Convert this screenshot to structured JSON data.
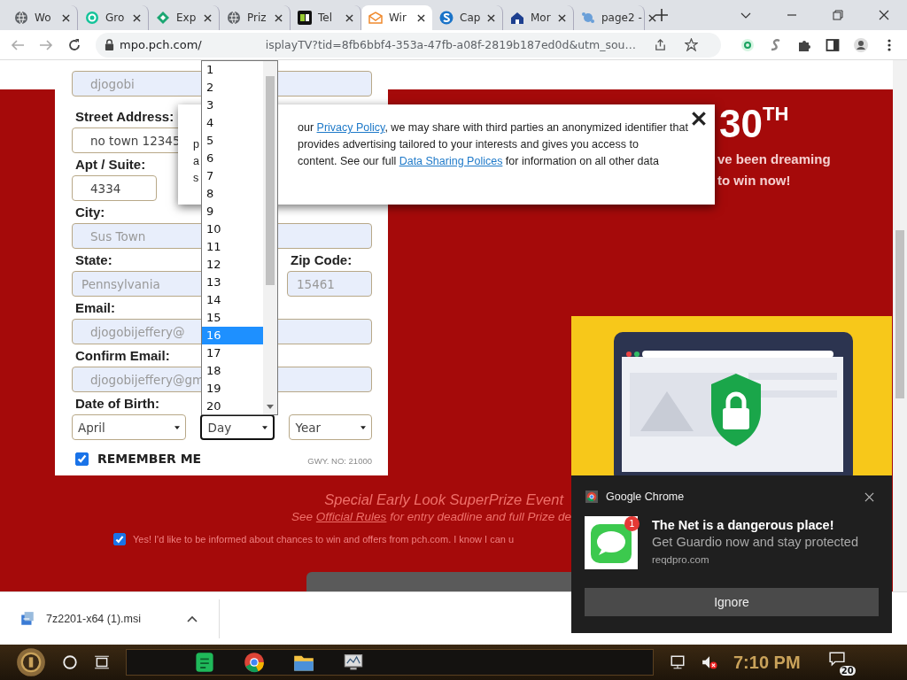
{
  "tabs": [
    {
      "label": "Wo",
      "kind": "globe",
      "selected": false
    },
    {
      "label": "Gro",
      "kind": "ring",
      "selected": false
    },
    {
      "label": "Exp",
      "kind": "diamond",
      "selected": false
    },
    {
      "label": "Priz",
      "kind": "globe",
      "selected": false
    },
    {
      "label": "Tel",
      "kind": "square",
      "selected": false
    },
    {
      "label": "Wir",
      "kind": "mail",
      "selected": true
    },
    {
      "label": "Cap",
      "kind": "circle",
      "selected": false
    },
    {
      "label": "Mor",
      "kind": "house",
      "selected": false
    },
    {
      "label": "page2 -",
      "kind": "splash",
      "selected": false
    }
  ],
  "address": {
    "start": "mpo.pch.com/",
    "end": "isplayTV?tid=8fb6bbf4-353a-47fb-a08f-2819b187ed0d&utm_sou…"
  },
  "form": {
    "top_value": "djogobi",
    "rows": [
      {
        "kind": "field",
        "label": "Street Address:",
        "value": "no town 12345",
        "disabled": false
      },
      {
        "kind": "short",
        "label": "Apt / Suite:",
        "value": "4334",
        "disabled": false
      },
      {
        "kind": "field",
        "label": "City:",
        "value": "Sus Town",
        "disabled": true
      },
      {
        "kind": "pair",
        "label": "State:",
        "value": "Pennsylvania",
        "disabled": true,
        "label_2": "Zip Code:",
        "value_2": "15461"
      },
      {
        "kind": "field",
        "label": "Email:",
        "value": "djogobijeffery@",
        "disabled": true
      },
      {
        "kind": "field",
        "label": "Confirm Email:",
        "value": "djogobijeffery@gm",
        "disabled": true
      },
      {
        "kind": "selects",
        "label": "Date of Birth:",
        "selects": [
          {
            "value": "April",
            "focused": false
          },
          {
            "value": "Day",
            "focused": true
          },
          {
            "value": "Year",
            "focused": false
          }
        ]
      }
    ],
    "remember": {
      "label": "REMEMBER ME",
      "checked": true
    },
    "gwy": "GWY. NO: 21000"
  },
  "hero": {
    "number": "30",
    "suffix": "TH",
    "lines": [
      "ve been dreaming",
      "to win now!"
    ]
  },
  "event": {
    "title": "Special Early Look SuperPrize Event",
    "rules_before": "See ",
    "rules_link": "Official Rules",
    "rules_after": " for entry deadline and full Prize de",
    "optin": {
      "checked": true,
      "text": "Yes! I'd like to be informed about chances to win and offers from pch.com. I know I can u"
    }
  },
  "popup": {
    "leads": [
      "p",
      "a",
      "s"
    ],
    "lines": [
      [
        {
          "text": "our ",
          "link": false
        },
        {
          "text": "Privacy Policy",
          "link": true
        },
        {
          "text": ", we may share with third parties an anonymized identifier that",
          "link": false
        }
      ],
      [
        {
          "text": "provides advertising tailored to your interests and gives you access to",
          "link": false
        }
      ],
      [
        {
          "text": "content. See our full ",
          "link": false
        },
        {
          "text": "Data Sharing Polices",
          "link": true
        },
        {
          "text": " for information on all other data",
          "link": false
        }
      ]
    ]
  },
  "dropdown": {
    "items": [
      {
        "label": "1",
        "selected": false
      },
      {
        "label": "2",
        "selected": false
      },
      {
        "label": "3",
        "selected": false
      },
      {
        "label": "4",
        "selected": false
      },
      {
        "label": "5",
        "selected": false
      },
      {
        "label": "6",
        "selected": false
      },
      {
        "label": "7",
        "selected": false
      },
      {
        "label": "8",
        "selected": false
      },
      {
        "label": "9",
        "selected": false
      },
      {
        "label": "10",
        "selected": false
      },
      {
        "label": "11",
        "selected": false
      },
      {
        "label": "12",
        "selected": false
      },
      {
        "label": "13",
        "selected": false
      },
      {
        "label": "14",
        "selected": false
      },
      {
        "label": "15",
        "selected": false
      },
      {
        "label": "16",
        "selected": true
      },
      {
        "label": "17",
        "selected": false
      },
      {
        "label": "18",
        "selected": false
      },
      {
        "label": "19",
        "selected": false
      },
      {
        "label": "20",
        "selected": false
      }
    ]
  },
  "notification": {
    "app": "Google Chrome",
    "title": "The Net is a dangerous place!",
    "body": "Get Guardio now and stay protected",
    "source": "reqdpro.com",
    "badge": "1",
    "button": "Ignore"
  },
  "download": {
    "file": "7z2201-x64 (1).msi"
  },
  "taskbar": {
    "time": "7:10 PM",
    "notifications": "20",
    "muted": true
  }
}
